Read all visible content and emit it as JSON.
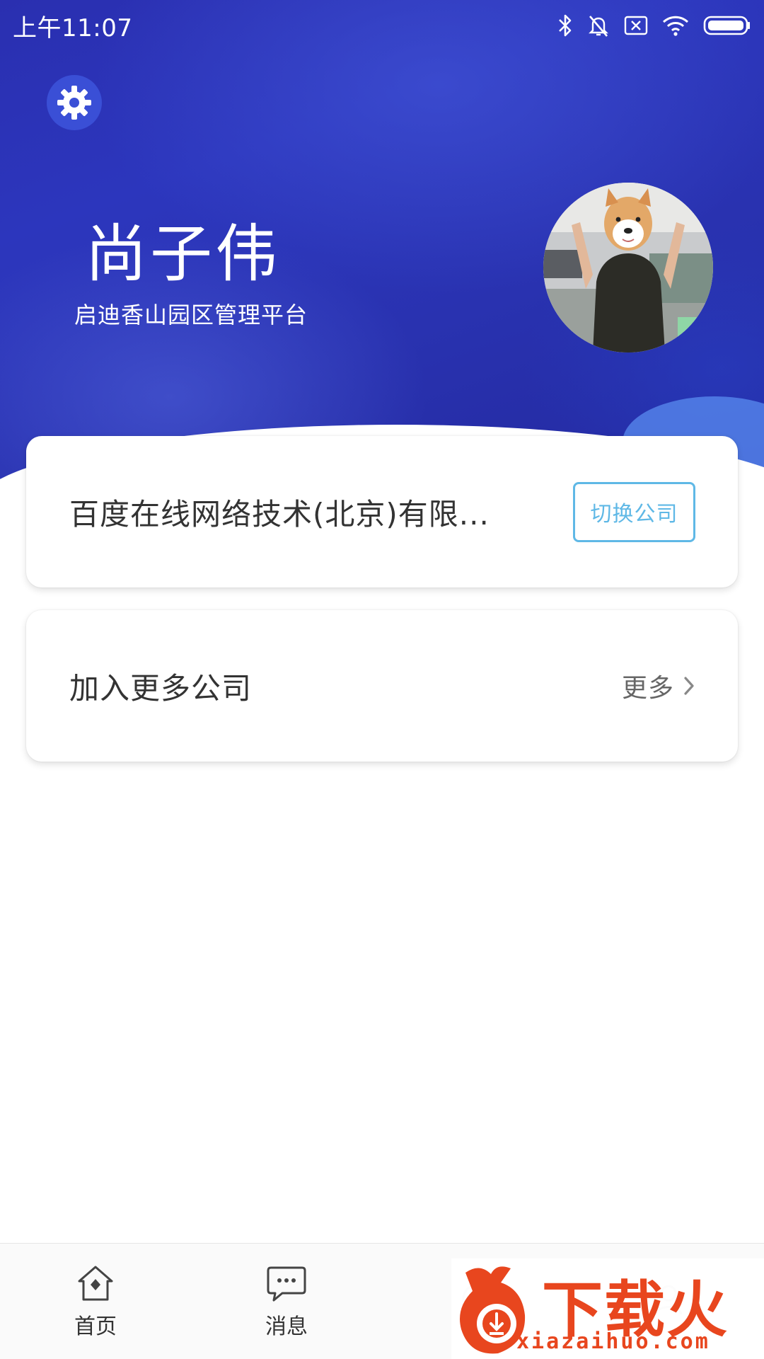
{
  "status_bar": {
    "time": "上午11:07"
  },
  "header": {
    "user_name": "尚子伟",
    "platform": "启迪香山园区管理平台"
  },
  "company_card": {
    "company_name": "百度在线网络技术(北京)有限...",
    "switch_label": "切换公司"
  },
  "join_card": {
    "label": "加入更多公司",
    "more_label": "更多"
  },
  "bottom_nav": {
    "items": [
      {
        "label": "首页",
        "icon": "home-icon"
      },
      {
        "label": "消息",
        "icon": "message-icon"
      },
      {
        "label": "",
        "icon": "interact-icon"
      },
      {
        "label": "",
        "icon": "profile-icon"
      }
    ]
  },
  "watermark": {
    "brand": "下载火",
    "url": "xiazaihuo.com"
  },
  "colors": {
    "header_blue": "#2a2fb0",
    "accent_cyan": "#5fb8e6",
    "watermark_orange": "#e8461e"
  }
}
